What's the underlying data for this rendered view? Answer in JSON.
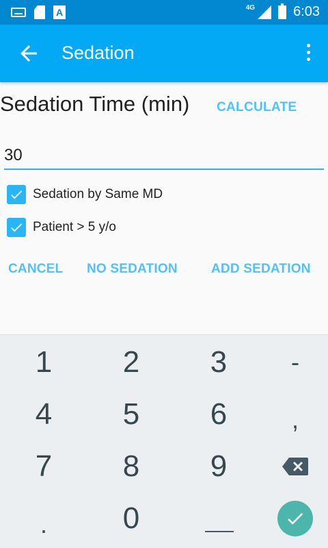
{
  "status_bar": {
    "time": "6:03",
    "network": "4G",
    "icons": [
      "keyboard-icon",
      "sd-card-icon",
      "text-icon",
      "signal-icon",
      "battery-charging-icon"
    ]
  },
  "app_bar": {
    "title": "Sedation",
    "back_icon": "arrow-back-icon",
    "menu_icon": "more-vert-icon"
  },
  "form": {
    "heading": "Sedation Time (min)",
    "calculate_label": "CALCULATE",
    "time_value": "30",
    "options": [
      {
        "label": "Sedation by Same MD",
        "checked": true
      },
      {
        "label": "Patient > 5 y/o",
        "checked": true
      }
    ]
  },
  "actions": {
    "cancel": "CANCEL",
    "no_sedation": "NO SEDATION",
    "add_sedation": "ADD SEDATION"
  },
  "keyboard": {
    "keys": [
      "1",
      "2",
      "3",
      "-",
      "4",
      "5",
      "6",
      ",",
      "7",
      "8",
      "9",
      ".",
      "0"
    ],
    "icons": [
      "backspace-icon",
      "done-check-icon",
      "space-icon"
    ]
  },
  "colors": {
    "status_bar": "#0288d1",
    "app_bar": "#03a9f4",
    "accent": "#4fc3f7",
    "checkbox": "#29b6f6",
    "enter_key": "#4db6ac"
  }
}
